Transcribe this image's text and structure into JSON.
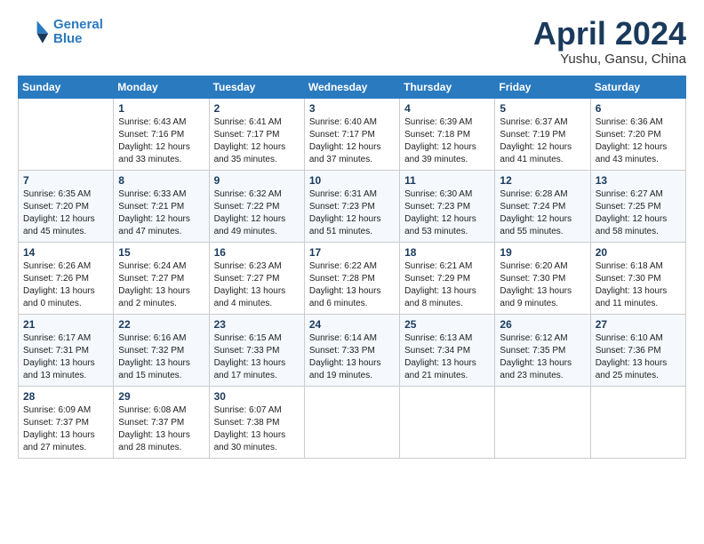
{
  "header": {
    "logo_line1": "General",
    "logo_line2": "Blue",
    "month_title": "April 2024",
    "location": "Yushu, Gansu, China"
  },
  "weekdays": [
    "Sunday",
    "Monday",
    "Tuesday",
    "Wednesday",
    "Thursday",
    "Friday",
    "Saturday"
  ],
  "weeks": [
    [
      {
        "day": "",
        "info": ""
      },
      {
        "day": "1",
        "info": "Sunrise: 6:43 AM\nSunset: 7:16 PM\nDaylight: 12 hours\nand 33 minutes."
      },
      {
        "day": "2",
        "info": "Sunrise: 6:41 AM\nSunset: 7:17 PM\nDaylight: 12 hours\nand 35 minutes."
      },
      {
        "day": "3",
        "info": "Sunrise: 6:40 AM\nSunset: 7:17 PM\nDaylight: 12 hours\nand 37 minutes."
      },
      {
        "day": "4",
        "info": "Sunrise: 6:39 AM\nSunset: 7:18 PM\nDaylight: 12 hours\nand 39 minutes."
      },
      {
        "day": "5",
        "info": "Sunrise: 6:37 AM\nSunset: 7:19 PM\nDaylight: 12 hours\nand 41 minutes."
      },
      {
        "day": "6",
        "info": "Sunrise: 6:36 AM\nSunset: 7:20 PM\nDaylight: 12 hours\nand 43 minutes."
      }
    ],
    [
      {
        "day": "7",
        "info": "Sunrise: 6:35 AM\nSunset: 7:20 PM\nDaylight: 12 hours\nand 45 minutes."
      },
      {
        "day": "8",
        "info": "Sunrise: 6:33 AM\nSunset: 7:21 PM\nDaylight: 12 hours\nand 47 minutes."
      },
      {
        "day": "9",
        "info": "Sunrise: 6:32 AM\nSunset: 7:22 PM\nDaylight: 12 hours\nand 49 minutes."
      },
      {
        "day": "10",
        "info": "Sunrise: 6:31 AM\nSunset: 7:23 PM\nDaylight: 12 hours\nand 51 minutes."
      },
      {
        "day": "11",
        "info": "Sunrise: 6:30 AM\nSunset: 7:23 PM\nDaylight: 12 hours\nand 53 minutes."
      },
      {
        "day": "12",
        "info": "Sunrise: 6:28 AM\nSunset: 7:24 PM\nDaylight: 12 hours\nand 55 minutes."
      },
      {
        "day": "13",
        "info": "Sunrise: 6:27 AM\nSunset: 7:25 PM\nDaylight: 12 hours\nand 58 minutes."
      }
    ],
    [
      {
        "day": "14",
        "info": "Sunrise: 6:26 AM\nSunset: 7:26 PM\nDaylight: 13 hours\nand 0 minutes."
      },
      {
        "day": "15",
        "info": "Sunrise: 6:24 AM\nSunset: 7:27 PM\nDaylight: 13 hours\nand 2 minutes."
      },
      {
        "day": "16",
        "info": "Sunrise: 6:23 AM\nSunset: 7:27 PM\nDaylight: 13 hours\nand 4 minutes."
      },
      {
        "day": "17",
        "info": "Sunrise: 6:22 AM\nSunset: 7:28 PM\nDaylight: 13 hours\nand 6 minutes."
      },
      {
        "day": "18",
        "info": "Sunrise: 6:21 AM\nSunset: 7:29 PM\nDaylight: 13 hours\nand 8 minutes."
      },
      {
        "day": "19",
        "info": "Sunrise: 6:20 AM\nSunset: 7:30 PM\nDaylight: 13 hours\nand 9 minutes."
      },
      {
        "day": "20",
        "info": "Sunrise: 6:18 AM\nSunset: 7:30 PM\nDaylight: 13 hours\nand 11 minutes."
      }
    ],
    [
      {
        "day": "21",
        "info": "Sunrise: 6:17 AM\nSunset: 7:31 PM\nDaylight: 13 hours\nand 13 minutes."
      },
      {
        "day": "22",
        "info": "Sunrise: 6:16 AM\nSunset: 7:32 PM\nDaylight: 13 hours\nand 15 minutes."
      },
      {
        "day": "23",
        "info": "Sunrise: 6:15 AM\nSunset: 7:33 PM\nDaylight: 13 hours\nand 17 minutes."
      },
      {
        "day": "24",
        "info": "Sunrise: 6:14 AM\nSunset: 7:33 PM\nDaylight: 13 hours\nand 19 minutes."
      },
      {
        "day": "25",
        "info": "Sunrise: 6:13 AM\nSunset: 7:34 PM\nDaylight: 13 hours\nand 21 minutes."
      },
      {
        "day": "26",
        "info": "Sunrise: 6:12 AM\nSunset: 7:35 PM\nDaylight: 13 hours\nand 23 minutes."
      },
      {
        "day": "27",
        "info": "Sunrise: 6:10 AM\nSunset: 7:36 PM\nDaylight: 13 hours\nand 25 minutes."
      }
    ],
    [
      {
        "day": "28",
        "info": "Sunrise: 6:09 AM\nSunset: 7:37 PM\nDaylight: 13 hours\nand 27 minutes."
      },
      {
        "day": "29",
        "info": "Sunrise: 6:08 AM\nSunset: 7:37 PM\nDaylight: 13 hours\nand 28 minutes."
      },
      {
        "day": "30",
        "info": "Sunrise: 6:07 AM\nSunset: 7:38 PM\nDaylight: 13 hours\nand 30 minutes."
      },
      {
        "day": "",
        "info": ""
      },
      {
        "day": "",
        "info": ""
      },
      {
        "day": "",
        "info": ""
      },
      {
        "day": "",
        "info": ""
      }
    ]
  ]
}
